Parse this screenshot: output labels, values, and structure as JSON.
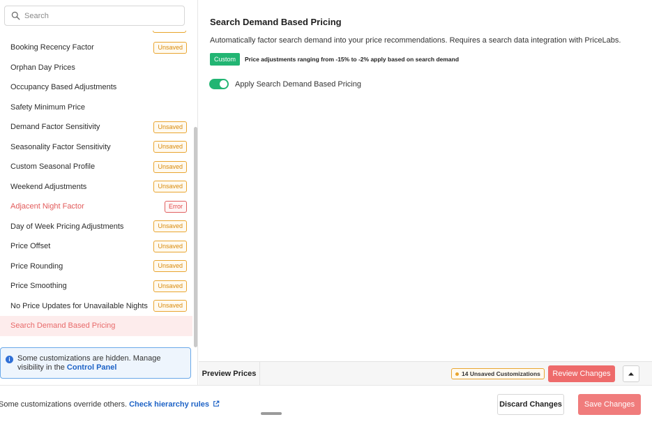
{
  "search": {
    "placeholder": "Search"
  },
  "sidebar": {
    "items": [
      {
        "label": "Booking Recency Factor",
        "badge": "Unsaved",
        "state": "unsaved"
      },
      {
        "label": "Orphan Day Prices",
        "badge": "",
        "state": ""
      },
      {
        "label": "Occupancy Based Adjustments",
        "badge": "",
        "state": ""
      },
      {
        "label": "Safety Minimum Price",
        "badge": "",
        "state": ""
      },
      {
        "label": "Demand Factor Sensitivity",
        "badge": "Unsaved",
        "state": "unsaved"
      },
      {
        "label": "Seasonality Factor Sensitivity",
        "badge": "Unsaved",
        "state": "unsaved"
      },
      {
        "label": "Custom Seasonal Profile",
        "badge": "Unsaved",
        "state": "unsaved"
      },
      {
        "label": "Weekend Adjustments",
        "badge": "Unsaved",
        "state": "unsaved"
      },
      {
        "label": "Adjacent Night Factor",
        "badge": "Error",
        "state": "error"
      },
      {
        "label": "Day of Week Pricing Adjustments",
        "badge": "Unsaved",
        "state": "unsaved"
      },
      {
        "label": "Price Offset",
        "badge": "Unsaved",
        "state": "unsaved"
      },
      {
        "label": "Price Rounding",
        "badge": "Unsaved",
        "state": "unsaved"
      },
      {
        "label": "Price Smoothing",
        "badge": "Unsaved",
        "state": "unsaved"
      },
      {
        "label": "No Price Updates for Unavailable Nights",
        "badge": "Unsaved",
        "state": "unsaved"
      },
      {
        "label": "Search Demand Based Pricing",
        "badge": "",
        "state": "active"
      }
    ]
  },
  "notice": {
    "text": "Some customizations are hidden. Manage visibility in the",
    "link": "Control Panel"
  },
  "main": {
    "title": "Search Demand Based Pricing",
    "description": "Automatically factor search demand into your price recommendations. Requires a search data integration with PriceLabs.",
    "custom_tag": "Custom",
    "custom_text": "Price adjustments ranging from -15% to -2% apply based on search demand",
    "toggle_label": "Apply Search Demand Based Pricing",
    "toggle_on": true
  },
  "preview": {
    "tab_label": "Preview Prices",
    "unsaved_count_label": "14 Unsaved Customizations",
    "review_label": "Review Changes"
  },
  "footer": {
    "text": "Some customizations override others.",
    "link": "Check hierarchy rules",
    "discard_label": "Discard Changes",
    "save_label": "Save Changes"
  },
  "colors": {
    "accent_green": "#22b573",
    "unsaved_orange": "#e9a530",
    "error_red": "#e04848",
    "primary_red": "#ee6b6b",
    "link_blue": "#1e63c6"
  }
}
